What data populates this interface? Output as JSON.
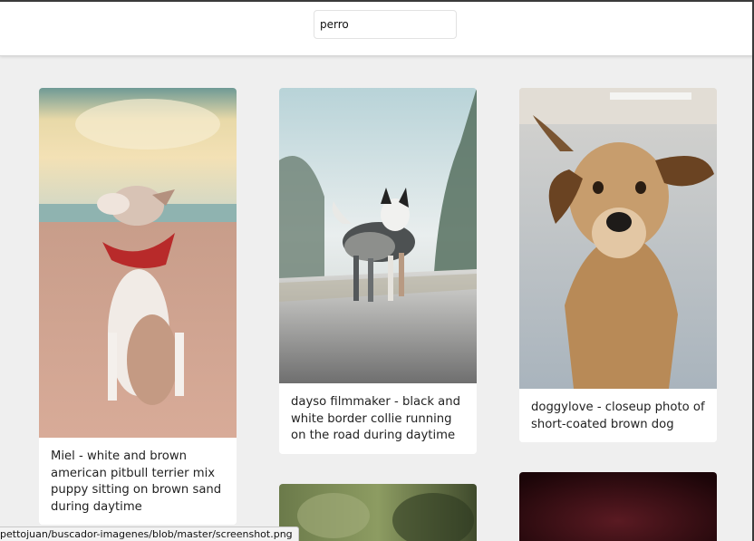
{
  "search": {
    "value": "perro"
  },
  "results": [
    {
      "caption": "Miel - white and brown american pitbull terrier mix puppy sitting on brown sand during daytime"
    },
    {
      "caption": "dayso filmmaker - black and white border collie running on the road during daytime"
    },
    {
      "caption": "doggylove - closeup photo of short-coated brown dog"
    },
    {
      "caption": ""
    },
    {
      "caption": ""
    }
  ],
  "status_bar": {
    "url_text": "pettojuan/buscador-imagenes/blob/master/screenshot.png"
  },
  "colors": {
    "page_background": "#efefef",
    "header_background": "#ffffff",
    "card_background": "#ffffff"
  }
}
